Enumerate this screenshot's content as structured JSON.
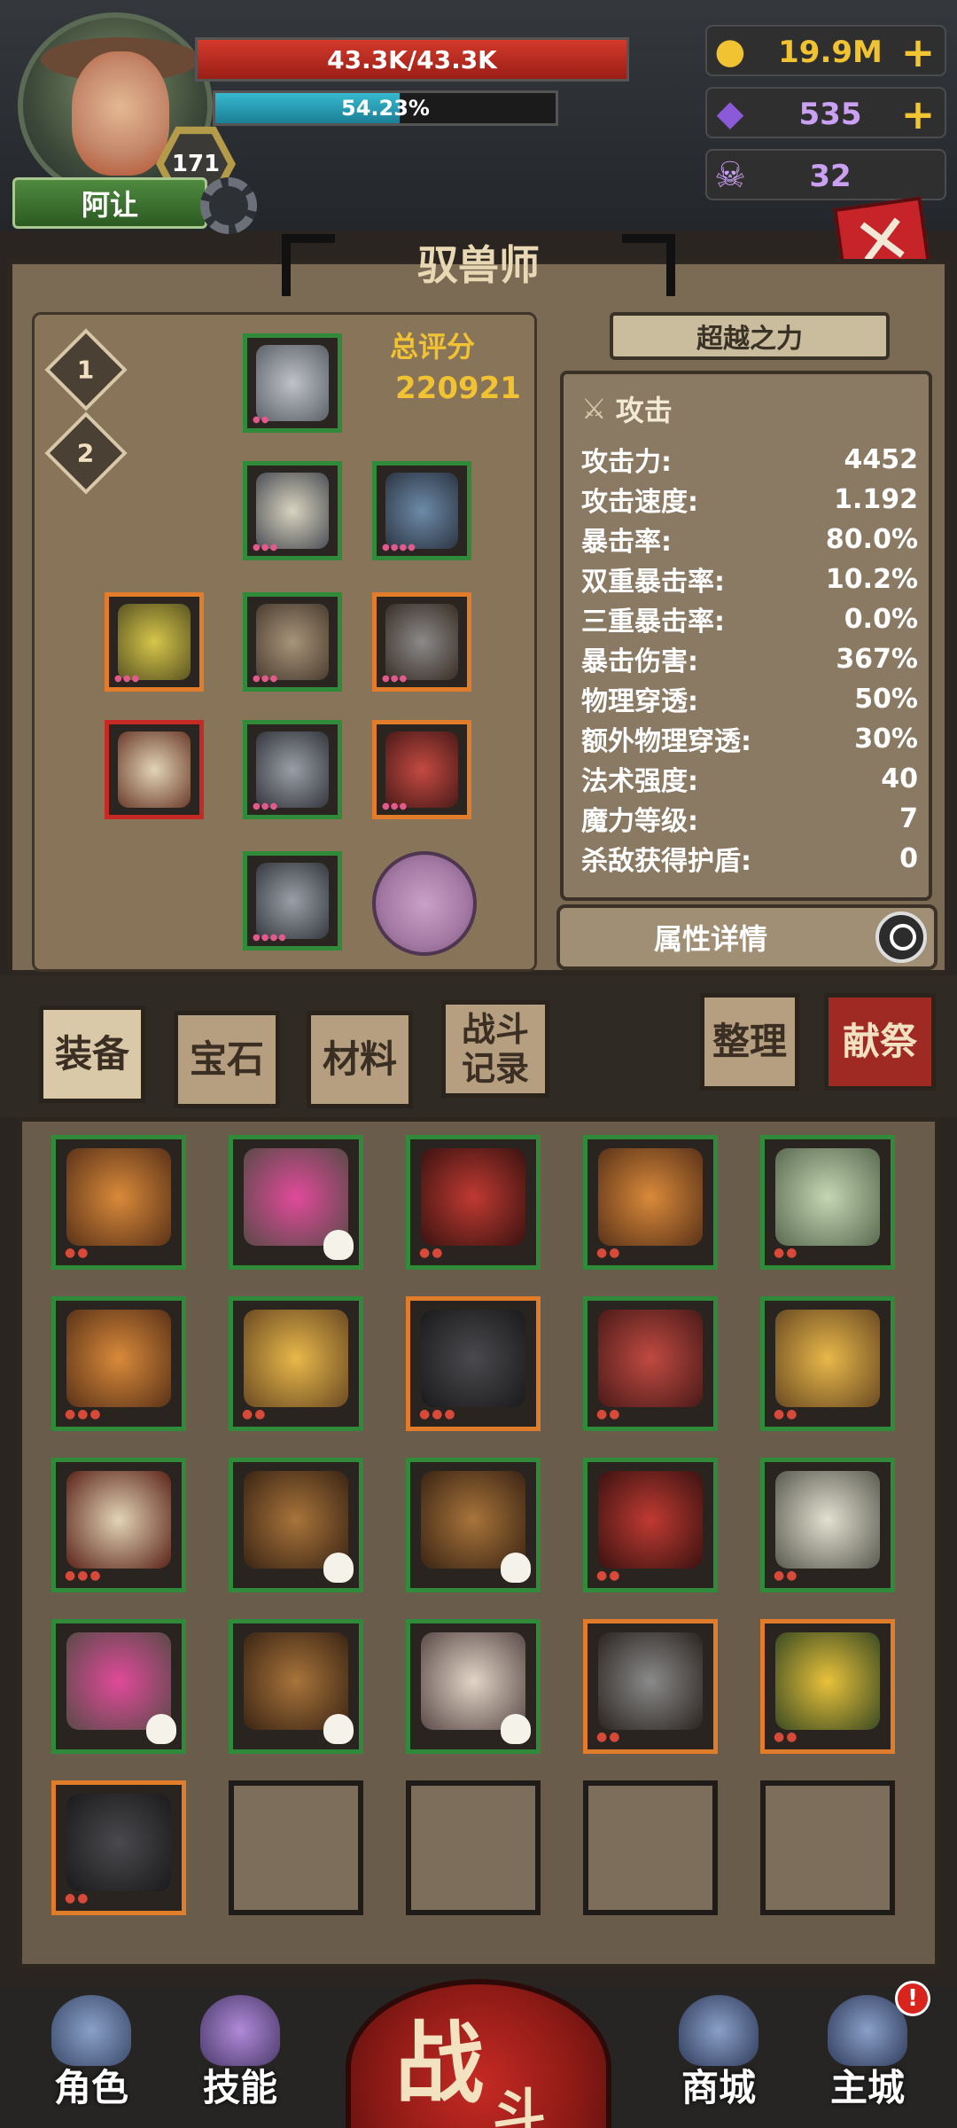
{
  "player": {
    "name": "阿让",
    "level": "171",
    "hp_text": "43.3K/43.3K",
    "hp_fraction": 1.0,
    "exp_text": "54.23%",
    "exp_fraction": 0.5423
  },
  "currencies": [
    {
      "icon": "gold-coin-icon",
      "value": "19.9M",
      "plus": "+"
    },
    {
      "icon": "purple-crystal-icon",
      "value": "535",
      "plus": "+"
    },
    {
      "icon": "ram-skull-icon",
      "value": "32"
    }
  ],
  "title": "驭兽师",
  "loadout_tabs": [
    "1",
    "2"
  ],
  "score": {
    "label": "总评分",
    "value": "220921"
  },
  "surpass_label": "超越之力",
  "stats": {
    "header": "攻击",
    "rows": [
      {
        "label": "攻击力:",
        "value": "4452"
      },
      {
        "label": "攻击速度:",
        "value": "1.192"
      },
      {
        "label": "暴击率:",
        "value": "80.0%"
      },
      {
        "label": "双重暴击率:",
        "value": "10.2%"
      },
      {
        "label": "三重暴击率:",
        "value": "0.0%"
      },
      {
        "label": "暴击伤害:",
        "value": "367%"
      },
      {
        "label": "物理穿透:",
        "value": "50%"
      },
      {
        "label": "额外物理穿透:",
        "value": "30%"
      },
      {
        "label": "法术强度:",
        "value": "40"
      },
      {
        "label": "魔力等级:",
        "value": "7"
      },
      {
        "label": "杀敌获得护盾:",
        "value": "0"
      }
    ]
  },
  "details_label": "属性详情",
  "tabs": {
    "equipment": "装备",
    "gems": "宝石",
    "materials": "材料",
    "battle_log": "战斗记录",
    "sort": "整理",
    "sacrifice": "献祭"
  },
  "colors": {
    "rarity_green": "#2f8a3a",
    "rarity_orange": "#e17d2a",
    "rarity_red": "#c72a24",
    "gold": "#f1c232"
  },
  "nav": {
    "character": "角色",
    "skills": "技能",
    "battle_main": "战",
    "battle_sub": "斗",
    "shop": "商城",
    "main_city": "主城",
    "alert": "!"
  }
}
